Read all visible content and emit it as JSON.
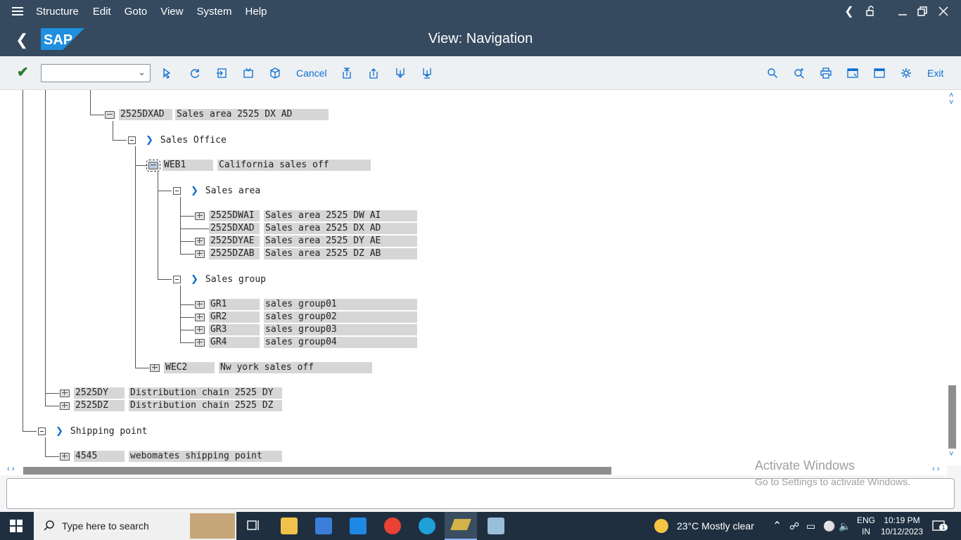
{
  "menu": {
    "items": [
      "Structure",
      "Edit",
      "Goto",
      "View",
      "System",
      "Help"
    ]
  },
  "title": {
    "page_title": "View: Navigation",
    "logo_text": "SAP"
  },
  "toolbar": {
    "command_value": "",
    "cancel_label": "Cancel",
    "exit_label": "Exit"
  },
  "tree": {
    "sales_area_node": {
      "key": "2525DXAD",
      "text": "Sales area 2525 DX AD"
    },
    "sales_office_label": "Sales Office",
    "web1": {
      "key": "WEB1",
      "text": "California sales off"
    },
    "sales_area_label": "Sales area",
    "sales_areas": [
      {
        "key": "2525DWAI",
        "text": "Sales area 2525 DW AI"
      },
      {
        "key": "2525DXAD",
        "text": "Sales area 2525 DX AD"
      },
      {
        "key": "2525DYAE",
        "text": "Sales area 2525 DY AE"
      },
      {
        "key": "2525DZAB",
        "text": "Sales area 2525 DZ AB"
      }
    ],
    "sales_group_label": "Sales group",
    "sales_groups": [
      {
        "key": "GR1",
        "text": "sales group01"
      },
      {
        "key": "GR2",
        "text": "sales group02"
      },
      {
        "key": "GR3",
        "text": "sales group03"
      },
      {
        "key": "GR4",
        "text": "sales group04"
      }
    ],
    "wec2": {
      "key": "WEC2",
      "text": "Nw york sales off"
    },
    "dist_chains": [
      {
        "key": "2525DY",
        "text": "Distribution chain 2525 DY"
      },
      {
        "key": "2525DZ",
        "text": "Distribution chain 2525 DZ"
      }
    ],
    "shipping_point_label": "Shipping point",
    "shipping": {
      "key": "4545",
      "text": "webomates shipping point"
    }
  },
  "watermark": {
    "line1": "Activate Windows",
    "line2": "Go to Settings to activate Windows."
  },
  "taskbar": {
    "search_placeholder": "Type here to search",
    "weather": "23°C  Mostly clear",
    "lang1": "ENG",
    "lang2": "IN",
    "time": "10:19 PM",
    "date": "10/12/2023",
    "notification_count": "1"
  }
}
